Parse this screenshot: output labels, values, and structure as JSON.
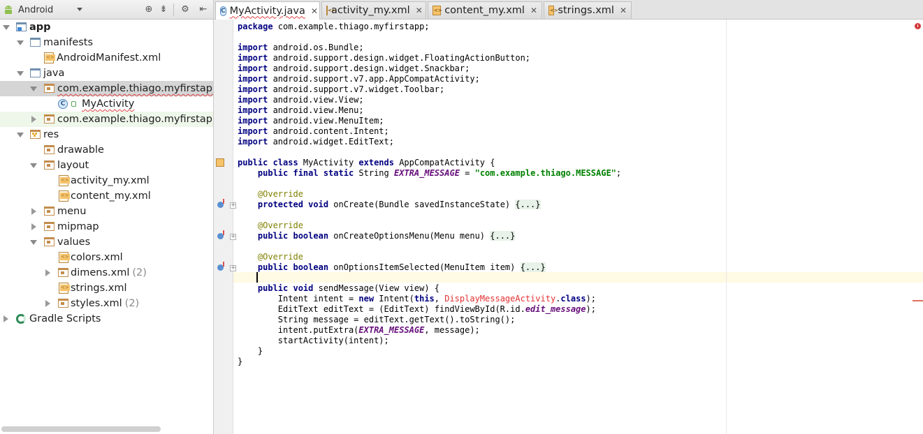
{
  "project_panel": {
    "view_selector": "Android",
    "tree": [
      {
        "label": "app",
        "bold": true
      },
      {
        "label": "manifests"
      },
      {
        "label": "AndroidManifest.xml"
      },
      {
        "label": "java"
      },
      {
        "label": "com.example.thiago.myfirstapp"
      },
      {
        "label": "MyActivity"
      },
      {
        "label": "com.example.thiago.myfirstapp"
      },
      {
        "label": "res"
      },
      {
        "label": "drawable"
      },
      {
        "label": "layout"
      },
      {
        "label": "activity_my.xml"
      },
      {
        "label": "content_my.xml"
      },
      {
        "label": "menu"
      },
      {
        "label": "mipmap"
      },
      {
        "label": "values"
      },
      {
        "label": "colors.xml"
      },
      {
        "label": "dimens.xml",
        "count": "(2)"
      },
      {
        "label": "strings.xml"
      },
      {
        "label": "styles.xml",
        "count": "(2)"
      },
      {
        "label": "Gradle Scripts"
      }
    ]
  },
  "tabs": [
    {
      "label": "MyActivity.java",
      "active": true
    },
    {
      "label": "activity_my.xml"
    },
    {
      "label": "content_my.xml"
    },
    {
      "label": "strings.xml"
    }
  ],
  "code": {
    "package": "com.example.thiago.myfirstapp;",
    "imports": [
      "android.os.Bundle;",
      "android.support.design.widget.FloatingActionButton;",
      "android.support.design.widget.Snackbar;",
      "android.support.v7.app.AppCompatActivity;",
      "android.support.v7.widget.Toolbar;",
      "android.view.View;",
      "android.view.Menu;",
      "android.view.MenuItem;",
      "android.content.Intent;",
      "android.widget.EditText;"
    ],
    "class_name": "MyActivity",
    "superclass": "AppCompatActivity {",
    "extra_type": "String",
    "extra_name": "EXTRA_MESSAGE",
    "extra_assign": " = ",
    "extra_value": "\"com.example.thiago.MESSAGE\"",
    "override": "@Override",
    "on_create_sig": "onCreate(Bundle savedInstanceState) ",
    "on_create_options_sig": "onCreateOptionsMenu(Menu menu) ",
    "on_options_item_sig": "onOptionsItemSelected(MenuItem item) ",
    "folded": "{...}",
    "send_message_sig": "sendMessage(View view) {",
    "body": {
      "intent_decl": "Intent intent = ",
      "intent_ctor": "Intent(",
      "intent_comma": ", ",
      "intent_target": "DisplayMessageActivity",
      "intent_dot": ".",
      "intent_end": ");",
      "edit_decl": "EditText editText = (EditText) findViewById(R.id.",
      "edit_id": "edit_message",
      "edit_end": ");",
      "message_line": "String message = editText.getText().toString();",
      "put_extra_start": "intent.putExtra(",
      "put_extra_end": ", message);",
      "start_activity": "startActivity(intent);"
    },
    "close_brace": "}"
  }
}
